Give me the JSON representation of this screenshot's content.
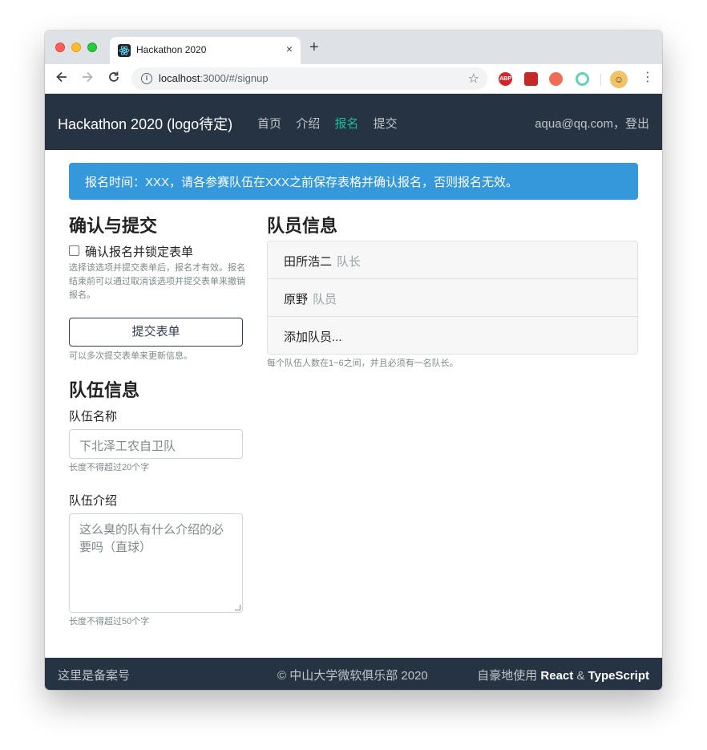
{
  "browser": {
    "tab_title": "Hackathon 2020",
    "tab_close": "×",
    "new_tab": "+",
    "url_host": "localhost",
    "url_path": ":3000/#/signup",
    "ext_abp": "ABP",
    "info": "i"
  },
  "navbar": {
    "brand": "Hackathon 2020 (logo待定)",
    "links": [
      {
        "label": "首页",
        "active": false
      },
      {
        "label": "介绍",
        "active": false
      },
      {
        "label": "报名",
        "active": true
      },
      {
        "label": "提交",
        "active": false
      }
    ],
    "user": "aqua@qq.com，登出"
  },
  "alert": {
    "text": "报名时间：XXX，请各参赛队伍在XXX之前保存表格并确认报名，否则报名无效。"
  },
  "confirm": {
    "heading": "确认与提交",
    "checkbox_label": "确认报名并锁定表单",
    "help": "选择该选项并提交表单后，报名才有效。报名结束前可以通过取消该选项并提交表单来撤销报名。",
    "submit_label": "提交表单",
    "submit_help": "可以多次提交表单来更新信息。"
  },
  "team": {
    "heading": "队伍信息",
    "name_label": "队伍名称",
    "name_placeholder": "下北泽工农自卫队",
    "name_help": "长度不得超过20个字",
    "intro_label": "队伍介绍",
    "intro_placeholder": "这么臭的队有什么介绍的必要吗（直球）",
    "intro_help": "长度不得超过50个字"
  },
  "members": {
    "heading": "队员信息",
    "list": [
      {
        "name": "田所浩二",
        "role": "队长"
      },
      {
        "name": "原野",
        "role": "队员"
      }
    ],
    "add_label": "添加队员...",
    "help": "每个队伍人数在1~6之间，并且必须有一名队长。"
  },
  "footer": {
    "left": "这里是备案号",
    "center": "© 中山大学微软俱乐部 2020",
    "right_prefix": "自豪地使用 ",
    "right_react": "React",
    "right_amp": " & ",
    "right_ts": "TypeScript"
  }
}
